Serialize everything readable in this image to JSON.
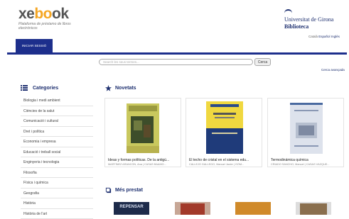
{
  "header": {
    "logo_prefix": "xe",
    "logo_o": "bo",
    "logo_suffix": "ok",
    "tagline": "Plataforma de préstamo de libros electrónicos",
    "university_name": "Universitat de Girona",
    "library_name": "Biblioteca",
    "language_label": "Català",
    "language_current": "Español",
    "language_other": "Inglés"
  },
  "nav": {
    "login_label": "INICIAR SESSIÓ"
  },
  "search": {
    "placeholder": "Search les seus termes...",
    "button_label": "Cerca",
    "advanced_label": "Cerca avançada"
  },
  "sidebar": {
    "title": "Categories",
    "items": [
      "Biologia i medi ambient",
      "Ciències de la salut",
      "Comunicació i cultural",
      "Dret i política",
      "Economia i empresa",
      "Educació i treball social",
      "Enginyeria i tecnologia",
      "Filosofia",
      "Física i química",
      "Geografia",
      "Història",
      "Història de l'art"
    ]
  },
  "novetats": {
    "title": "Novetats",
    "books": [
      {
        "title": "Ideas y formas políticas. De la antigü...",
        "author": "MARTÍNEZ ARANCÓN, Ana | CASAS BAAMO..."
      },
      {
        "title": "El techo de cristal en el sistema edu...",
        "author": "CALLEJO GALLEGO, Manuel Javier | GÓM..."
      },
      {
        "title": "Termodinámica química",
        "author": "CRIADO SANCHO, Manuel | CASAS VÁZQUE..."
      }
    ]
  },
  "mes_prestat": {
    "title": "Més prestat",
    "cover_text": "REPENSAR"
  },
  "colors": {
    "primary": "#1d2f8c",
    "accent": "#f5a623"
  }
}
